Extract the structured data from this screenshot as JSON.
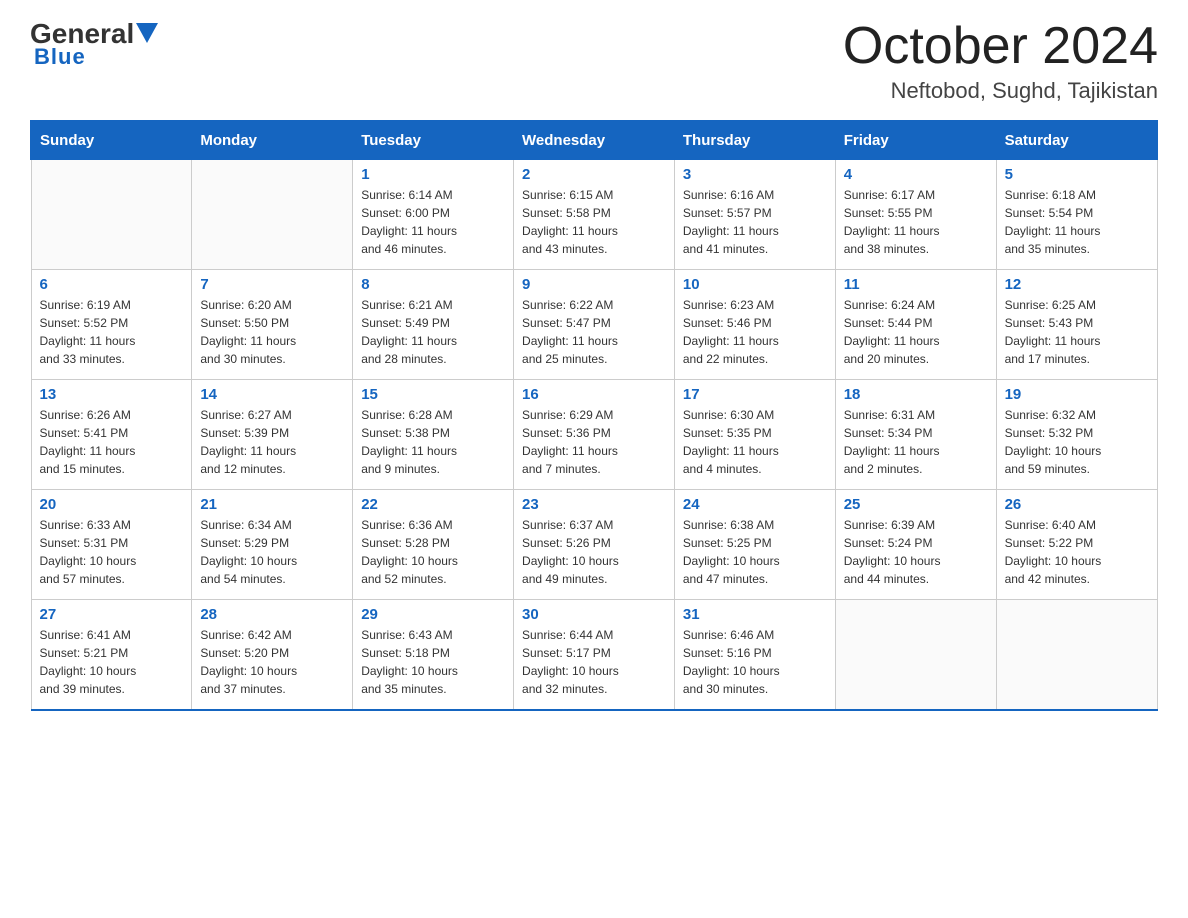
{
  "header": {
    "logo_general": "General",
    "logo_blue": "Blue",
    "month_title": "October 2024",
    "location": "Neftobod, Sughd, Tajikistan"
  },
  "weekdays": [
    "Sunday",
    "Monday",
    "Tuesday",
    "Wednesday",
    "Thursday",
    "Friday",
    "Saturday"
  ],
  "weeks": [
    [
      {
        "day": "",
        "info": ""
      },
      {
        "day": "",
        "info": ""
      },
      {
        "day": "1",
        "info": "Sunrise: 6:14 AM\nSunset: 6:00 PM\nDaylight: 11 hours\nand 46 minutes."
      },
      {
        "day": "2",
        "info": "Sunrise: 6:15 AM\nSunset: 5:58 PM\nDaylight: 11 hours\nand 43 minutes."
      },
      {
        "day": "3",
        "info": "Sunrise: 6:16 AM\nSunset: 5:57 PM\nDaylight: 11 hours\nand 41 minutes."
      },
      {
        "day": "4",
        "info": "Sunrise: 6:17 AM\nSunset: 5:55 PM\nDaylight: 11 hours\nand 38 minutes."
      },
      {
        "day": "5",
        "info": "Sunrise: 6:18 AM\nSunset: 5:54 PM\nDaylight: 11 hours\nand 35 minutes."
      }
    ],
    [
      {
        "day": "6",
        "info": "Sunrise: 6:19 AM\nSunset: 5:52 PM\nDaylight: 11 hours\nand 33 minutes."
      },
      {
        "day": "7",
        "info": "Sunrise: 6:20 AM\nSunset: 5:50 PM\nDaylight: 11 hours\nand 30 minutes."
      },
      {
        "day": "8",
        "info": "Sunrise: 6:21 AM\nSunset: 5:49 PM\nDaylight: 11 hours\nand 28 minutes."
      },
      {
        "day": "9",
        "info": "Sunrise: 6:22 AM\nSunset: 5:47 PM\nDaylight: 11 hours\nand 25 minutes."
      },
      {
        "day": "10",
        "info": "Sunrise: 6:23 AM\nSunset: 5:46 PM\nDaylight: 11 hours\nand 22 minutes."
      },
      {
        "day": "11",
        "info": "Sunrise: 6:24 AM\nSunset: 5:44 PM\nDaylight: 11 hours\nand 20 minutes."
      },
      {
        "day": "12",
        "info": "Sunrise: 6:25 AM\nSunset: 5:43 PM\nDaylight: 11 hours\nand 17 minutes."
      }
    ],
    [
      {
        "day": "13",
        "info": "Sunrise: 6:26 AM\nSunset: 5:41 PM\nDaylight: 11 hours\nand 15 minutes."
      },
      {
        "day": "14",
        "info": "Sunrise: 6:27 AM\nSunset: 5:39 PM\nDaylight: 11 hours\nand 12 minutes."
      },
      {
        "day": "15",
        "info": "Sunrise: 6:28 AM\nSunset: 5:38 PM\nDaylight: 11 hours\nand 9 minutes."
      },
      {
        "day": "16",
        "info": "Sunrise: 6:29 AM\nSunset: 5:36 PM\nDaylight: 11 hours\nand 7 minutes."
      },
      {
        "day": "17",
        "info": "Sunrise: 6:30 AM\nSunset: 5:35 PM\nDaylight: 11 hours\nand 4 minutes."
      },
      {
        "day": "18",
        "info": "Sunrise: 6:31 AM\nSunset: 5:34 PM\nDaylight: 11 hours\nand 2 minutes."
      },
      {
        "day": "19",
        "info": "Sunrise: 6:32 AM\nSunset: 5:32 PM\nDaylight: 10 hours\nand 59 minutes."
      }
    ],
    [
      {
        "day": "20",
        "info": "Sunrise: 6:33 AM\nSunset: 5:31 PM\nDaylight: 10 hours\nand 57 minutes."
      },
      {
        "day": "21",
        "info": "Sunrise: 6:34 AM\nSunset: 5:29 PM\nDaylight: 10 hours\nand 54 minutes."
      },
      {
        "day": "22",
        "info": "Sunrise: 6:36 AM\nSunset: 5:28 PM\nDaylight: 10 hours\nand 52 minutes."
      },
      {
        "day": "23",
        "info": "Sunrise: 6:37 AM\nSunset: 5:26 PM\nDaylight: 10 hours\nand 49 minutes."
      },
      {
        "day": "24",
        "info": "Sunrise: 6:38 AM\nSunset: 5:25 PM\nDaylight: 10 hours\nand 47 minutes."
      },
      {
        "day": "25",
        "info": "Sunrise: 6:39 AM\nSunset: 5:24 PM\nDaylight: 10 hours\nand 44 minutes."
      },
      {
        "day": "26",
        "info": "Sunrise: 6:40 AM\nSunset: 5:22 PM\nDaylight: 10 hours\nand 42 minutes."
      }
    ],
    [
      {
        "day": "27",
        "info": "Sunrise: 6:41 AM\nSunset: 5:21 PM\nDaylight: 10 hours\nand 39 minutes."
      },
      {
        "day": "28",
        "info": "Sunrise: 6:42 AM\nSunset: 5:20 PM\nDaylight: 10 hours\nand 37 minutes."
      },
      {
        "day": "29",
        "info": "Sunrise: 6:43 AM\nSunset: 5:18 PM\nDaylight: 10 hours\nand 35 minutes."
      },
      {
        "day": "30",
        "info": "Sunrise: 6:44 AM\nSunset: 5:17 PM\nDaylight: 10 hours\nand 32 minutes."
      },
      {
        "day": "31",
        "info": "Sunrise: 6:46 AM\nSunset: 5:16 PM\nDaylight: 10 hours\nand 30 minutes."
      },
      {
        "day": "",
        "info": ""
      },
      {
        "day": "",
        "info": ""
      }
    ]
  ]
}
